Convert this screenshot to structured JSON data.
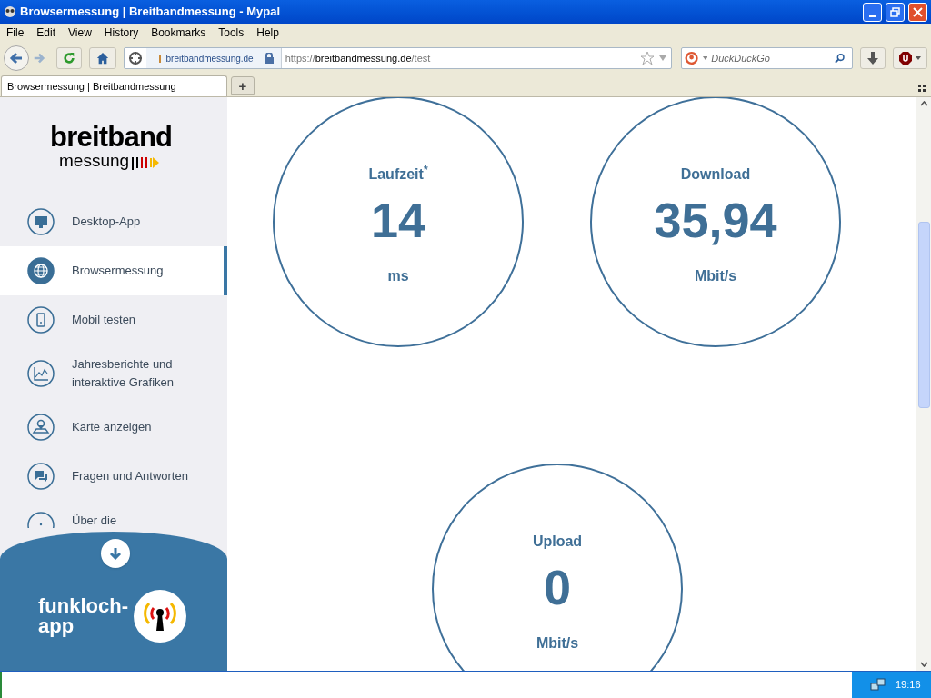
{
  "window": {
    "title": "Browsermessung | Breitbandmessung - Mypal"
  },
  "menu": [
    "File",
    "Edit",
    "View",
    "History",
    "Bookmarks",
    "Tools",
    "Help"
  ],
  "address_bar": {
    "site": "breitbandmessung.de",
    "scheme": "https://",
    "host": "breitbandmessung.de",
    "path": "/test"
  },
  "search": {
    "placeholder": "DuckDuckGo"
  },
  "tabs": [
    {
      "label": "Browsermessung | Breitbandmessung",
      "selected": true
    }
  ],
  "new_tab": "+",
  "sidebar": {
    "logo_top": "breitband",
    "logo_bottom": "messung",
    "items": [
      {
        "label": "Desktop-App",
        "selected": false
      },
      {
        "label": "Browsermessung",
        "selected": true
      },
      {
        "label": "Mobil testen",
        "selected": false
      },
      {
        "label": "Jahresberichte und interaktive Grafiken",
        "selected": false
      },
      {
        "label": "Karte anzeigen",
        "selected": false
      },
      {
        "label": "Fragen und Antworten",
        "selected": false
      },
      {
        "label": "Über die",
        "selected": false
      }
    ],
    "promo": [
      "funkloch-",
      "app"
    ]
  },
  "metrics": [
    {
      "label": "Laufzeit$^{*}$",
      "value": "14",
      "unit": "ms"
    },
    {
      "label": "Download",
      "value": "35,94",
      "unit": "Mbit/s"
    },
    {
      "label": "Upload",
      "value": "0",
      "unit": "Mbit/s"
    }
  ],
  "taskbar": {
    "clock": "19:16"
  }
}
